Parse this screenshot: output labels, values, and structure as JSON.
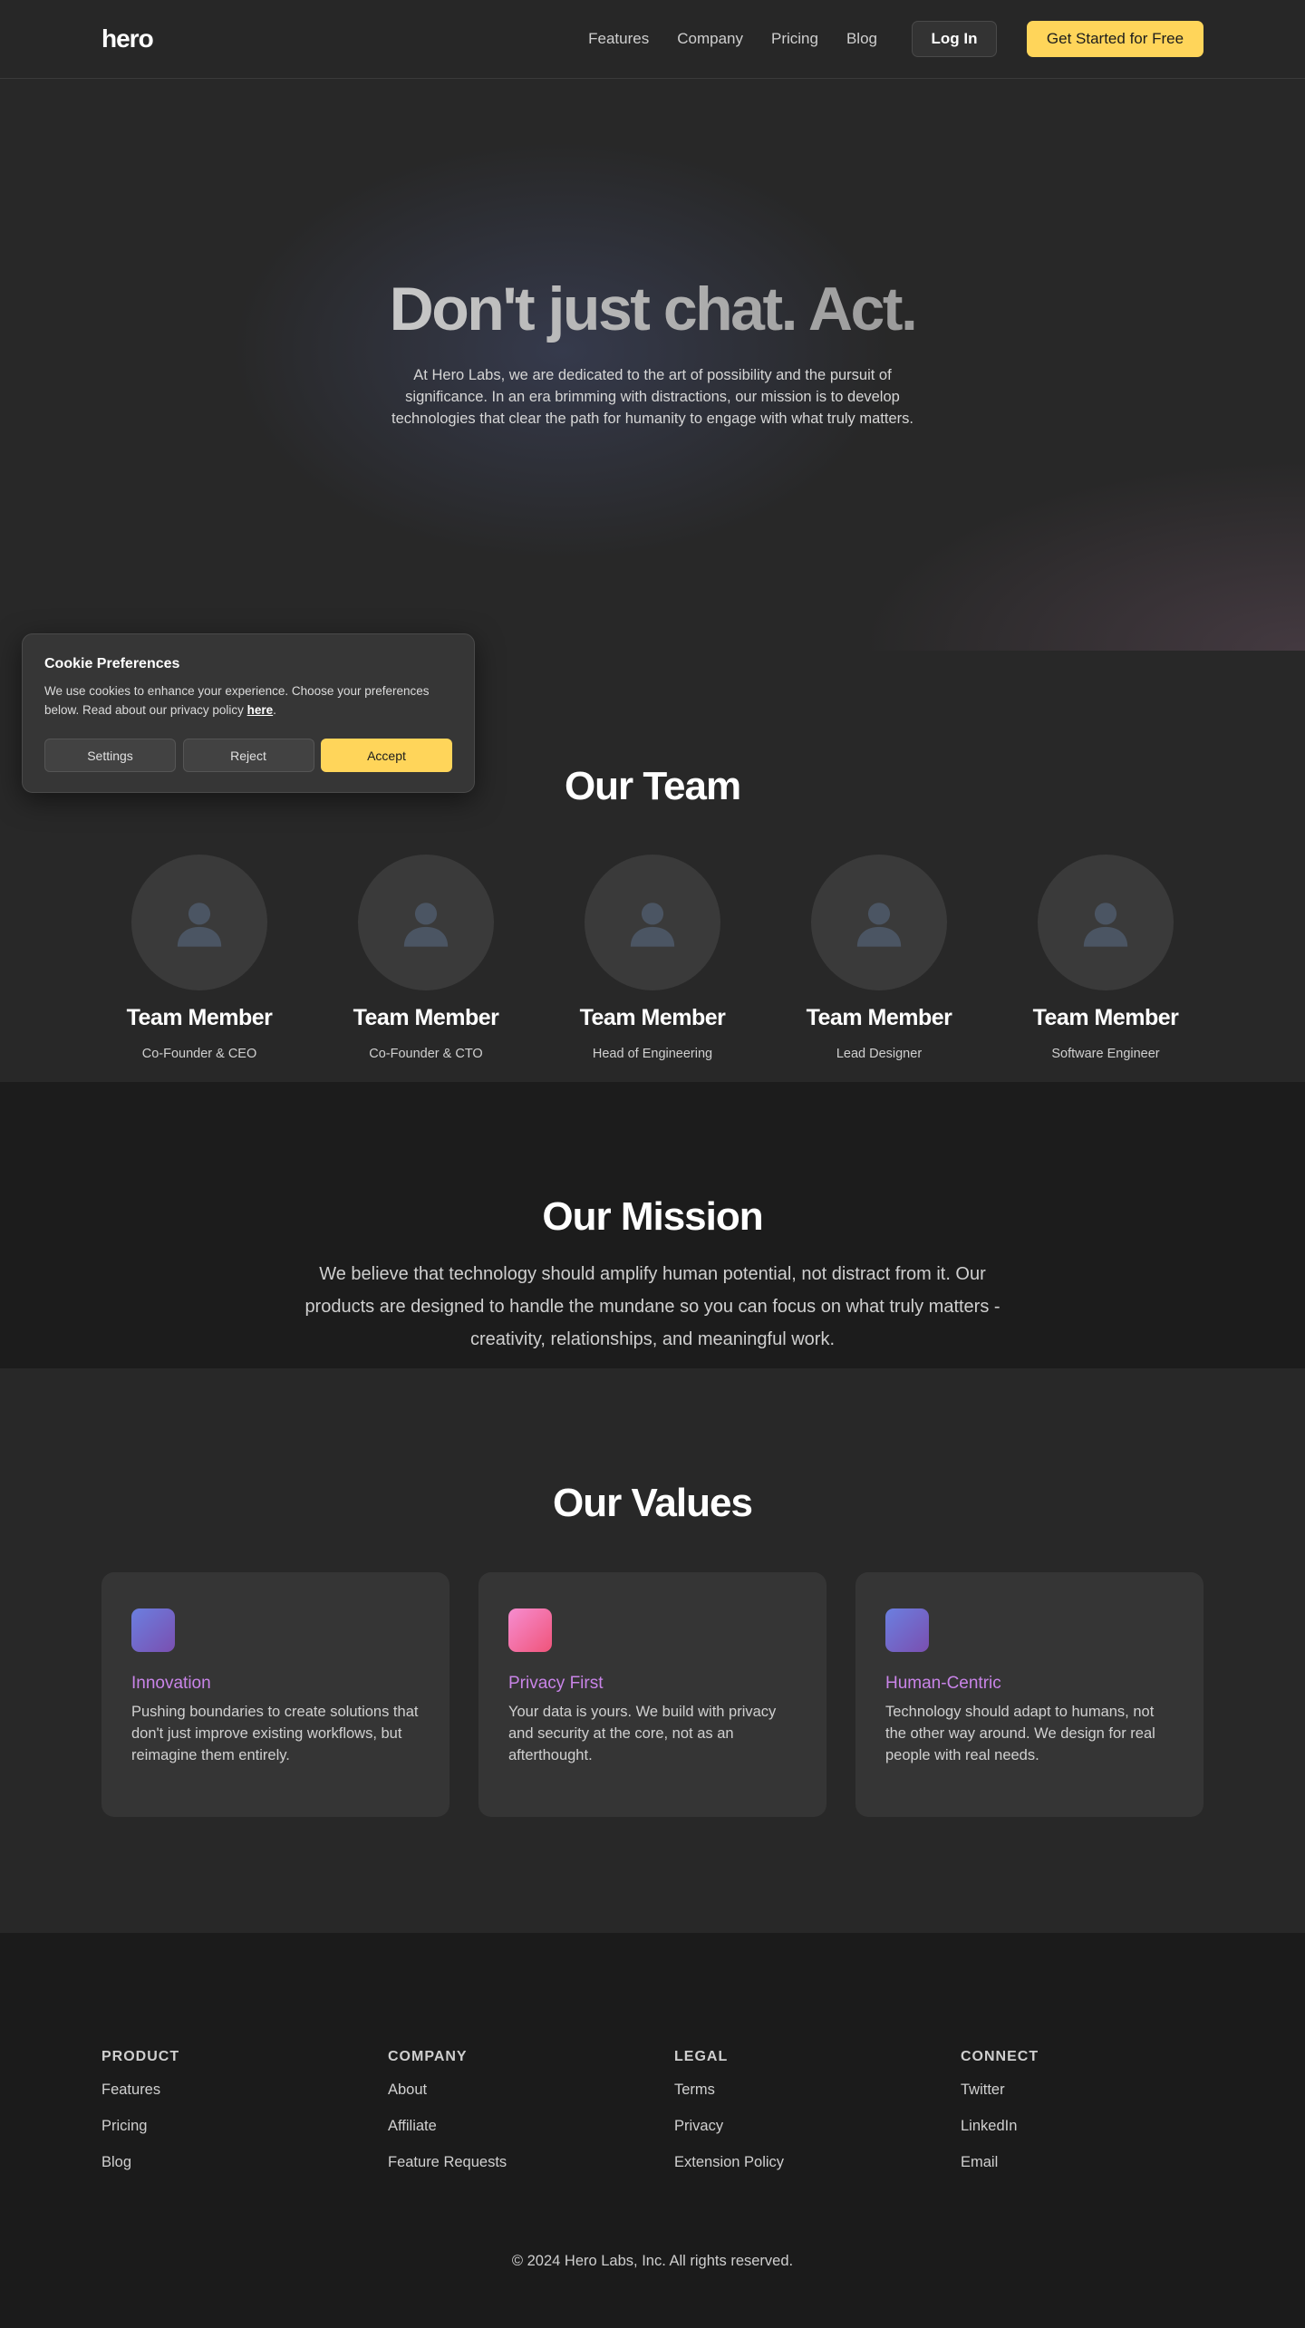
{
  "nav": {
    "logo": "hero",
    "links": [
      "Features",
      "Company",
      "Pricing",
      "Blog"
    ],
    "login_label": "Log In",
    "cta_label": "Get Started for Free"
  },
  "hero": {
    "title": "Don't just chat. Act.",
    "subtitle": "At Hero Labs, we are dedicated to the art of possibility and the pursuit of significance. In an era brimming with distractions, our mission is to develop technologies that clear the path for humanity to engage with what truly matters."
  },
  "team": {
    "title": "Our Team",
    "members": [
      {
        "name": "Team Member",
        "role": "Co-Founder & CEO"
      },
      {
        "name": "Team Member",
        "role": "Co-Founder & CTO"
      },
      {
        "name": "Team Member",
        "role": "Head of Engineering"
      },
      {
        "name": "Team Member",
        "role": "Lead Designer"
      },
      {
        "name": "Team Member",
        "role": "Software Engineer"
      }
    ]
  },
  "mission": {
    "title": "Our Mission",
    "text": "We believe that technology should amplify human potential, not distract from it. Our products are designed to handle the mundane so you can focus on what truly matters - creativity, relationships, and meaningful work."
  },
  "values": {
    "title": "Our Values",
    "items": [
      {
        "title": "Innovation",
        "text": "Pushing boundaries to create solutions that don't just improve existing workflows, but reimagine them entirely."
      },
      {
        "title": "Privacy First",
        "text": "Your data is yours. We build with privacy and security at the core, not as an afterthought."
      },
      {
        "title": "Human-Centric",
        "text": "Technology should adapt to humans, not the other way around. We design for real people with real needs."
      }
    ]
  },
  "footer": {
    "columns": [
      {
        "heading": "PRODUCT",
        "links": [
          "Features",
          "Pricing",
          "Blog"
        ]
      },
      {
        "heading": "COMPANY",
        "links": [
          "About",
          "Affiliate",
          "Feature Requests"
        ]
      },
      {
        "heading": "LEGAL",
        "links": [
          "Terms",
          "Privacy",
          "Extension Policy"
        ]
      },
      {
        "heading": "CONNECT",
        "links": [
          "Twitter",
          "LinkedIn",
          "Email"
        ]
      }
    ],
    "copyright": "© 2024 Hero Labs, Inc. All rights reserved."
  },
  "cookie": {
    "title": "Cookie Preferences",
    "text": "We use cookies to enhance your experience. Choose your preferences below. Read about our privacy policy ",
    "link_label": "here",
    "text_end": ".",
    "settings_label": "Settings",
    "reject_label": "Reject",
    "accept_label": "Accept"
  },
  "colors": {
    "accent": "#ffd55a",
    "value_title": "#c984e8",
    "background": "#282828"
  }
}
